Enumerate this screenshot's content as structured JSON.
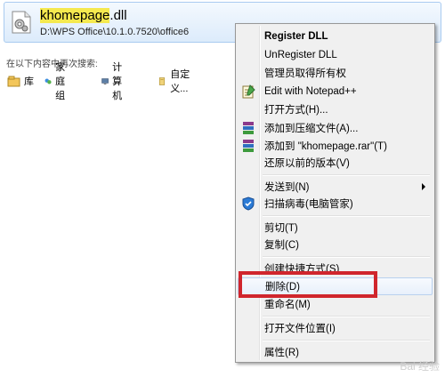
{
  "result": {
    "name_highlight": "khomepage",
    "name_rest": ".dll",
    "path": "D:\\WPS Office\\10.1.0.7520\\office6"
  },
  "search_again_label": "在以下内容中再次搜索:",
  "locations": [
    {
      "label": "库",
      "icon": "library-icon"
    },
    {
      "label": "家庭组",
      "icon": "homegroup-icon"
    },
    {
      "label": "计算机",
      "icon": "computer-icon"
    },
    {
      "label": "自定义...",
      "icon": "custom-folder-icon"
    }
  ],
  "menu": {
    "items": [
      {
        "label": "Register DLL",
        "bold": true
      },
      {
        "label": "UnRegister DLL"
      },
      {
        "label": "管理员取得所有权"
      },
      {
        "label": "Edit with Notepad++",
        "icon": "notepad-icon"
      },
      {
        "label": "打开方式(H)..."
      },
      {
        "label": "添加到压缩文件(A)...",
        "icon": "winrar-icon"
      },
      {
        "label": "添加到 \"khomepage.rar\"(T)",
        "icon": "winrar-icon"
      },
      {
        "label": "还原以前的版本(V)"
      },
      {
        "label": "发送到(N)",
        "submenu": true
      },
      {
        "label": "扫描病毒(电脑管家)",
        "icon": "shield-icon"
      },
      {
        "label": "剪切(T)"
      },
      {
        "label": "复制(C)"
      },
      {
        "label": "创建快捷方式(S)"
      },
      {
        "label": "删除(D)"
      },
      {
        "label": "重命名(M)"
      },
      {
        "label": "打开文件位置(I)"
      },
      {
        "label": "属性(R)"
      }
    ]
  },
  "watermark": "Bai 经验"
}
